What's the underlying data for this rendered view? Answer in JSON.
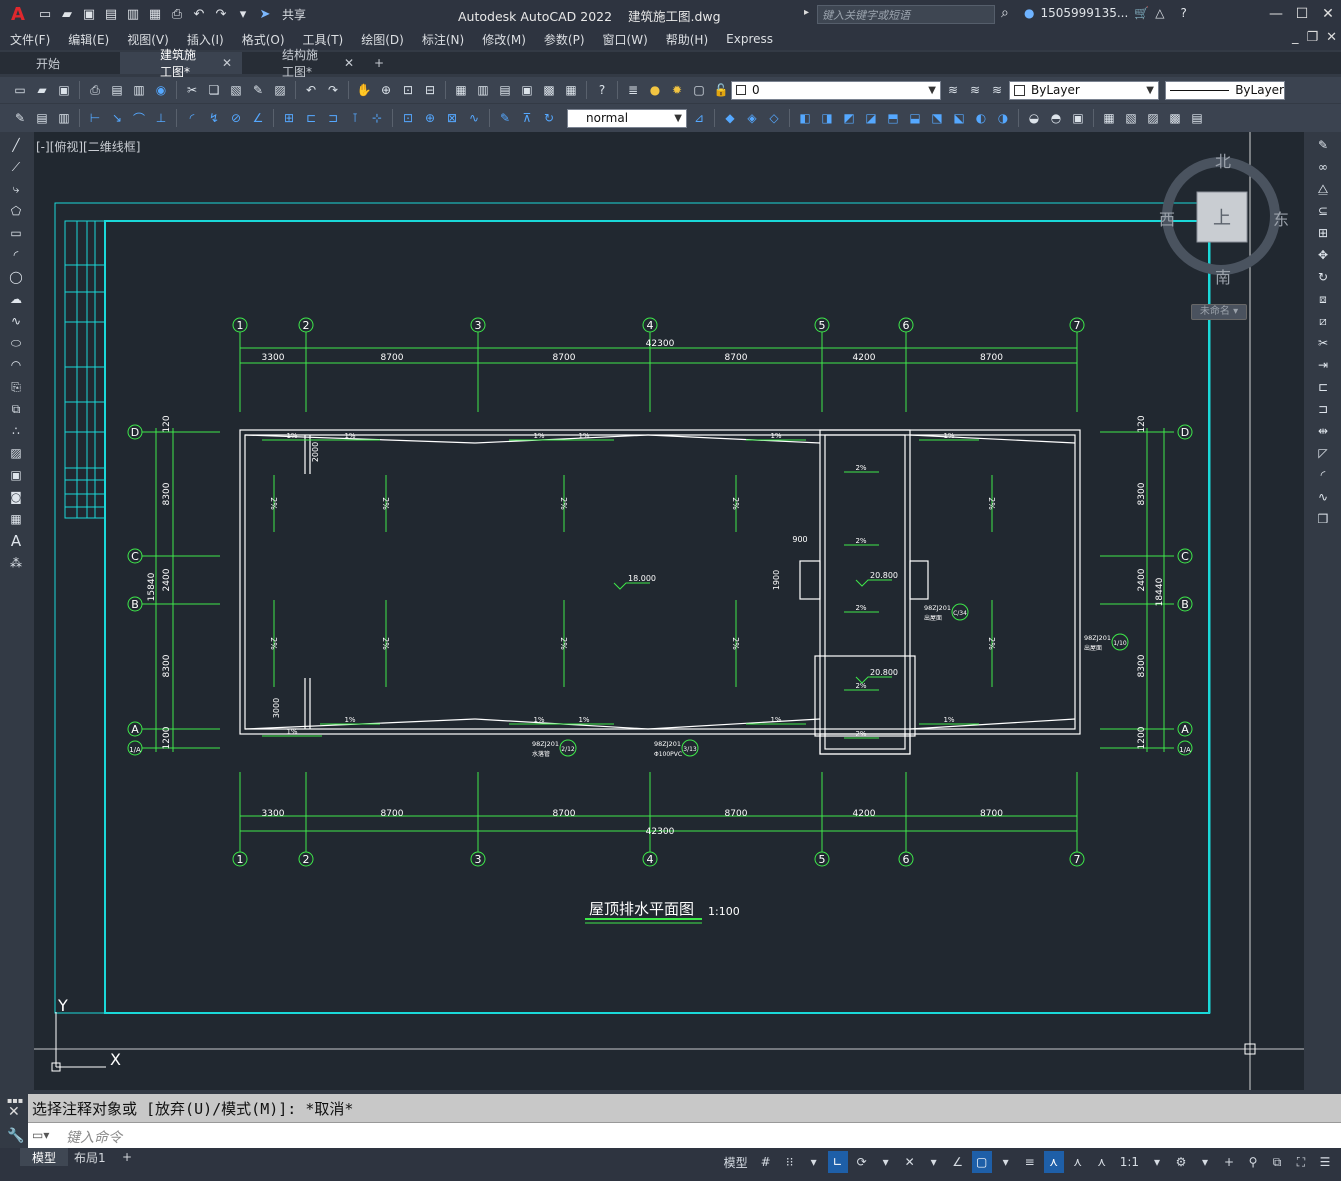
{
  "app": {
    "title": "Autodesk AutoCAD 2022    建筑施工图.dwg",
    "logo": "A",
    "share_label": "共享",
    "search_placeholder": "键入关键字或短语",
    "user": "1505999135...",
    "icons": [
      "new-icon",
      "open-icon",
      "save-icon",
      "saveas-icon",
      "plot-icon",
      "undo-icon",
      "redo-icon",
      "share-icon"
    ]
  },
  "menu": [
    "文件(F)",
    "编辑(E)",
    "视图(V)",
    "插入(I)",
    "格式(O)",
    "工具(T)",
    "绘图(D)",
    "标注(N)",
    "修改(M)",
    "参数(P)",
    "窗口(W)",
    "帮助(H)",
    "Express"
  ],
  "doc_tabs": [
    {
      "label": "开始",
      "active": false,
      "closable": false
    },
    {
      "label": "建筑施工图*",
      "active": true,
      "closable": true
    },
    {
      "label": "结构施工图*",
      "active": false,
      "closable": true
    }
  ],
  "toolbar": {
    "layer_value": "0",
    "color_value": "ByLayer",
    "linetype_value": "ByLayer",
    "textstyle_value": "normal"
  },
  "viewport": {
    "label": "[-][俯视][二维线框]",
    "compass": {
      "north": "北",
      "south": "南",
      "east": "东",
      "west": "西",
      "top": "上",
      "wcs": "未命名"
    }
  },
  "drawing": {
    "title": "屋顶排水平面图",
    "scale": "1:100",
    "axes_top": [
      "1",
      "2",
      "3",
      "4",
      "5",
      "6",
      "7"
    ],
    "axes_side": [
      "D",
      "C",
      "B",
      "A",
      "1/A"
    ],
    "dims_top": [
      "3300",
      "8700",
      "8700",
      "8700",
      "4200",
      "8700"
    ],
    "dims_total": "42300",
    "dims_left": [
      "120",
      "8300",
      "2400",
      "8300",
      "120",
      "1200"
    ],
    "dims_left_total": "15840",
    "dims_right_total": "18440",
    "elevations": [
      "18.000",
      "20.800",
      "20.800"
    ],
    "slope": "2%",
    "slope_small": "1%",
    "dims_misc": [
      "2000",
      "3000",
      "900",
      "1900"
    ],
    "detail_refs": [
      "98ZJ201",
      "98ZJ201",
      "98ZJ201",
      "98ZJ201"
    ],
    "detail_nums": [
      "2/12",
      "3/13",
      "C/34",
      "1/10"
    ],
    "notes": [
      "水落管",
      "Φ100PVC",
      "出屋面",
      "出屋面"
    ],
    "ucs_x": "X",
    "ucs_y": "Y"
  },
  "command": {
    "history": "选择注释对象或 [放弃(U)/模式(M)]: *取消*",
    "placeholder": "键入命令"
  },
  "layout_tabs": [
    "模型",
    "布局1"
  ],
  "status": {
    "model": "模型",
    "scale": "1:1"
  }
}
